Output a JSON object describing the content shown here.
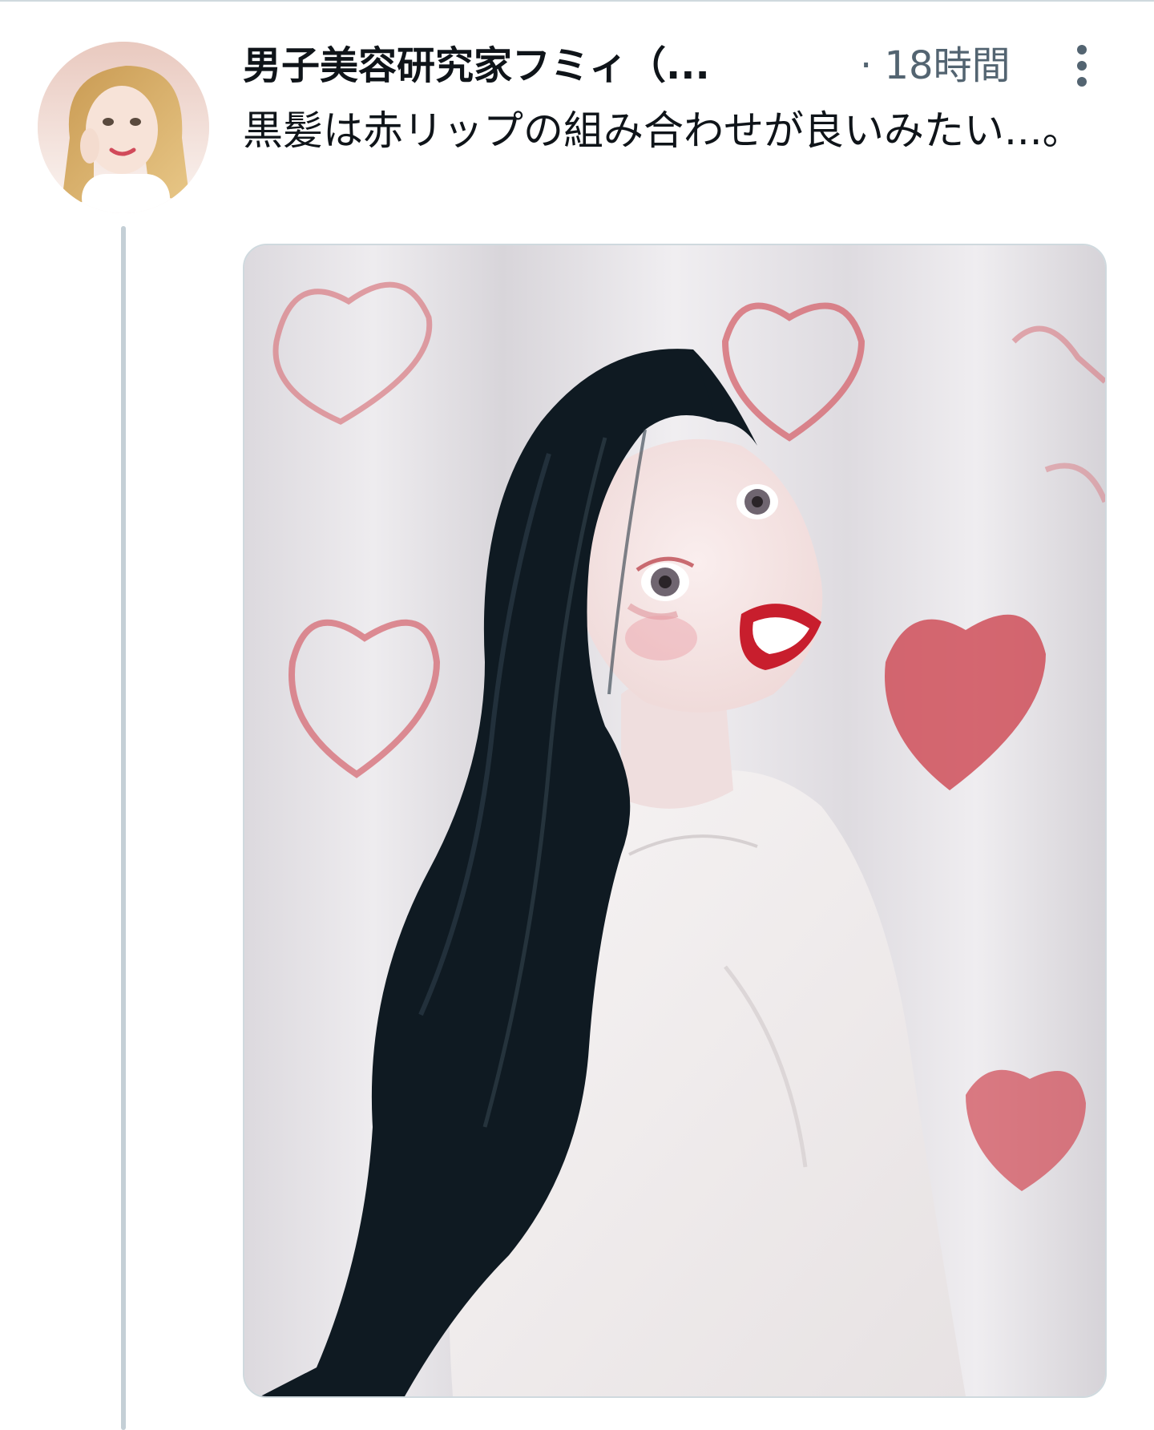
{
  "tweet": {
    "author": {
      "display_name": "男子美容研究家フミィ（...",
      "avatar_icon": "profile-photo"
    },
    "timestamp": "· 18時間",
    "more_icon": "more-vertical-icon",
    "text": "黒髪は赤リップの組み合わせが良いみたい...。",
    "media": {
      "type": "photo",
      "icon": "photo-image"
    }
  },
  "colors": {
    "text_primary": "#0f1419",
    "text_secondary": "#536471",
    "thread_line": "#c4cfd6",
    "divider": "#cfd9de"
  }
}
